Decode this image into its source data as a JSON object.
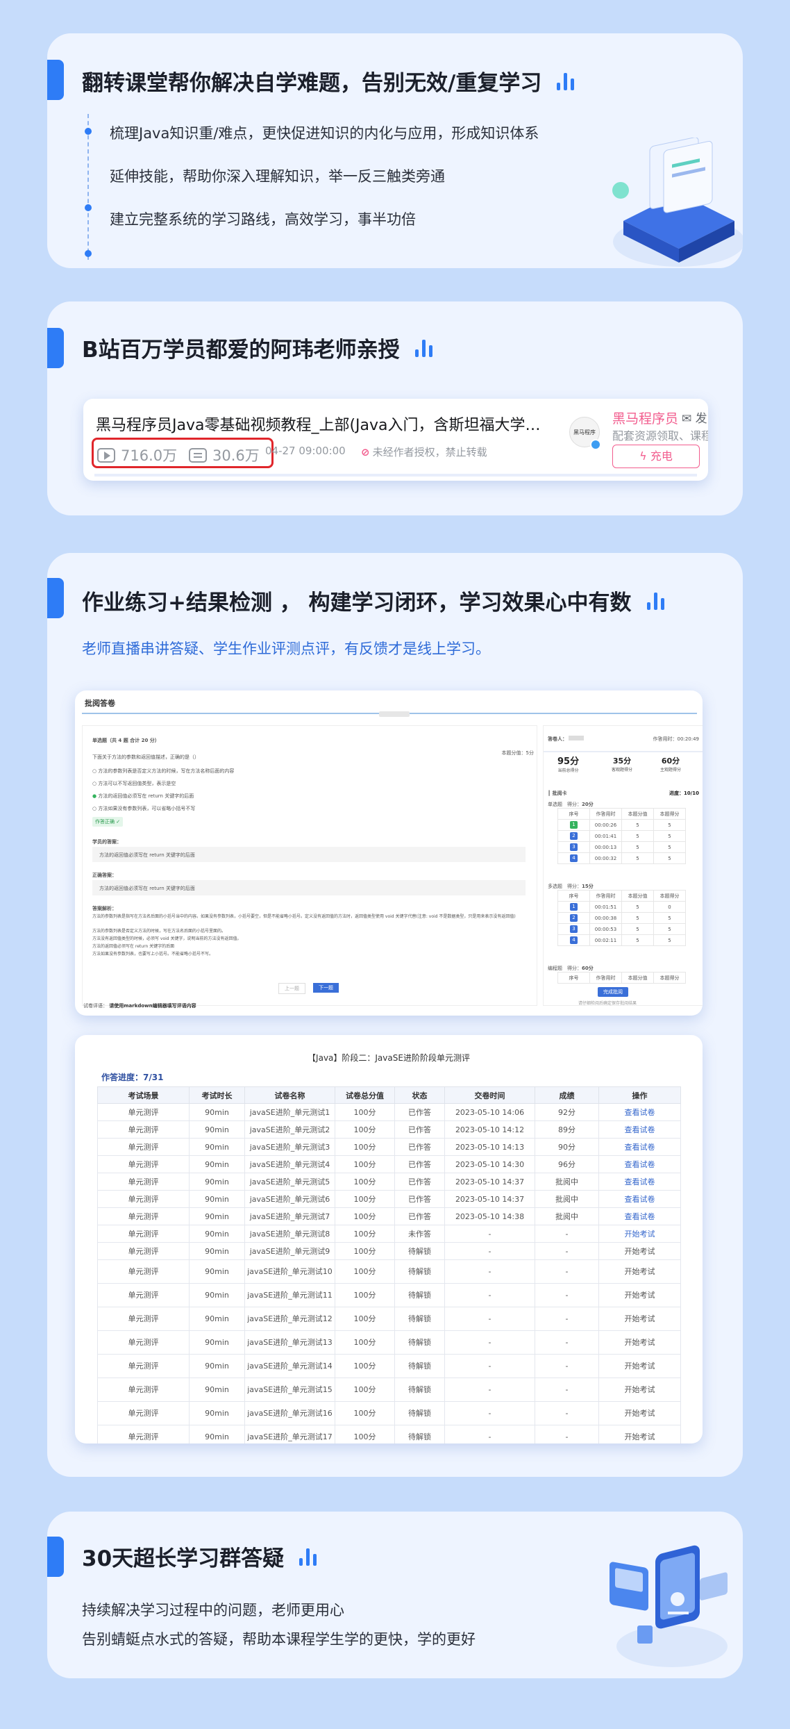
{
  "section1": {
    "title": "翻转课堂帮你解决自学难题，告别无效/重复学习",
    "bullets": [
      "梳理Java知识重/难点，更快促进知识的内化与应用，形成知识体系",
      "延伸技能，帮助你深入理解知识，举一反三触类旁通",
      "建立完整系统的学习路线，高效学习，事半功倍"
    ]
  },
  "section2": {
    "title": "B站百万学员都爱的阿玮老师亲授",
    "video": {
      "title": "黑马程序员Java零基础视频教程_上部(Java入门，含斯坦福大学…",
      "views": "716.0万",
      "danmaku": "30.6万",
      "date": "04-27 09:00:00",
      "notice": "未经作者授权，禁止转载",
      "uploader": "黑马程序员",
      "message": "发",
      "uploader_desc": "配套资源领取、课程",
      "avatar_text": "黑马程序",
      "charge": "充电"
    }
  },
  "section3": {
    "title": "作业练习+结果检测 ， 构建学习闭环，学习效果心中有数",
    "subtitle": "老师直播串讲答疑、学生作业评测点评，有反馈才是线上学习。",
    "grading": {
      "title": "批阅答卷",
      "question_header": "单选题（共 4 题 合计 20 分）",
      "question_score": "本题分值：5分",
      "question": "下面关于方法的参数和返回值描述，正确的是（）",
      "options": [
        "方法的参数列表是否定义方法的时候，写在方法名称后面的内容",
        "方法可以不写返回值类型，表示是空",
        "方法的返回值必须写在 return 关键字的后面",
        "方法如果没有参数列表，可以省略小括号不写"
      ],
      "correct_tag": "作答正确",
      "student_answer_label": "学员的答案：",
      "student_answer": "方法的返回值必须写在 return 关键字的后面",
      "correct_answer_label": "正确答案：",
      "correct_answer": "方法的返回值必须写在 return 关键字的后面",
      "analysis_label": "答案解析：",
      "analysis_lines": [
        "方法的参数列表是指写在方法名后面的小括号当中的内容。如果没有参数列表，小括号要空，但是不能省略小括号。定义没有返回值的方法时，返回值类型使用 void 关键字代替(注意: void 不是数据类型，只是用来表示没有返回值)",
        "方法的参数列表是否定义方法的时候，写在方法名后面的小括号里面的。",
        "方法没有返回值类型的时候，必须写 void 关键字，说明当前的方法没有返回值。",
        "方法的返回值必须写在 return 关键字的后面",
        "方法如果没有参数列表，也要写上小括号。不能省略小括号不写。"
      ],
      "prev": "上一题",
      "next": "下一题",
      "comment_label": "试卷评语：",
      "comment_placeholder": "请使用markdown编辑器填写评语内容",
      "answerer_label": "答卷人：",
      "time_label": "作答用时：",
      "time": "00:20:49",
      "scores": [
        {
          "value": "95分",
          "label": "当前总得分"
        },
        {
          "value": "35分",
          "label": "客观题得分"
        },
        {
          "value": "60分",
          "label": "主观题得分"
        }
      ],
      "panel_title": "批阅卡",
      "progress": "进度：10/10",
      "groups": [
        {
          "name": "单选题",
          "score_label": "得分：",
          "score": "20分",
          "rows": [
            [
              "1",
              "00:00:26",
              "5",
              "5"
            ],
            [
              "2",
              "00:01:41",
              "5",
              "5"
            ],
            [
              "3",
              "00:00:13",
              "5",
              "5"
            ],
            [
              "4",
              "00:00:32",
              "5",
              "5"
            ]
          ]
        },
        {
          "name": "多选题",
          "score_label": "得分：",
          "score": "15分",
          "rows": [
            [
              "1",
              "00:01:51",
              "5",
              "0"
            ],
            [
              "2",
              "00:00:38",
              "5",
              "5"
            ],
            [
              "3",
              "00:00:53",
              "5",
              "5"
            ],
            [
              "4",
              "00:02:11",
              "5",
              "5"
            ]
          ]
        },
        {
          "name": "编程题",
          "score_label": "得分：",
          "score": "60分",
          "rows": []
        }
      ],
      "mini_headers": [
        "序号",
        "作答用时",
        "本题分值",
        "本题得分"
      ],
      "finish_button": "完成批阅",
      "finish_hint": "请仔细检阅后确定保存批阅结果"
    },
    "exam": {
      "title": "【Java】阶段二：JavaSE进阶阶段单元测评",
      "progress": "作答进度：7/31",
      "headers": [
        "考试场景",
        "考试时长",
        "试卷名称",
        "试卷总分值",
        "状态",
        "交卷时间",
        "成绩",
        "操作"
      ],
      "rows": [
        [
          "单元测评",
          "90min",
          "javaSE进阶_单元测试1",
          "100分",
          "已作答",
          "2023-05-10 14:06",
          "92分",
          "查看试卷"
        ],
        [
          "单元测评",
          "90min",
          "javaSE进阶_单元测试2",
          "100分",
          "已作答",
          "2023-05-10 14:12",
          "89分",
          "查看试卷"
        ],
        [
          "单元测评",
          "90min",
          "javaSE进阶_单元测试3",
          "100分",
          "已作答",
          "2023-05-10 14:13",
          "90分",
          "查看试卷"
        ],
        [
          "单元测评",
          "90min",
          "javaSE进阶_单元测试4",
          "100分",
          "已作答",
          "2023-05-10 14:30",
          "96分",
          "查看试卷"
        ],
        [
          "单元测评",
          "90min",
          "javaSE进阶_单元测试5",
          "100分",
          "已作答",
          "2023-05-10 14:37",
          "批阅中",
          "查看试卷"
        ],
        [
          "单元测评",
          "90min",
          "javaSE进阶_单元测试6",
          "100分",
          "已作答",
          "2023-05-10 14:37",
          "批阅中",
          "查看试卷"
        ],
        [
          "单元测评",
          "90min",
          "javaSE进阶_单元测试7",
          "100分",
          "已作答",
          "2023-05-10 14:38",
          "批阅中",
          "查看试卷"
        ],
        [
          "单元测评",
          "90min",
          "javaSE进阶_单元测试8",
          "100分",
          "未作答",
          "-",
          "-",
          "开始考试"
        ],
        [
          "单元测评",
          "90min",
          "javaSE进阶_单元测试9",
          "100分",
          "待解锁",
          "-",
          "-",
          "开始考试"
        ],
        [
          "单元测评",
          "90min",
          "javaSE进阶_单元测试10",
          "100分",
          "待解锁",
          "-",
          "-",
          "开始考试"
        ],
        [
          "单元测评",
          "90min",
          "javaSE进阶_单元测试11",
          "100分",
          "待解锁",
          "-",
          "-",
          "开始考试"
        ],
        [
          "单元测评",
          "90min",
          "javaSE进阶_单元测试12",
          "100分",
          "待解锁",
          "-",
          "-",
          "开始考试"
        ],
        [
          "单元测评",
          "90min",
          "javaSE进阶_单元测试13",
          "100分",
          "待解锁",
          "-",
          "-",
          "开始考试"
        ],
        [
          "单元测评",
          "90min",
          "javaSE进阶_单元测试14",
          "100分",
          "待解锁",
          "-",
          "-",
          "开始考试"
        ],
        [
          "单元测评",
          "90min",
          "javaSE进阶_单元测试15",
          "100分",
          "待解锁",
          "-",
          "-",
          "开始考试"
        ],
        [
          "单元测评",
          "90min",
          "javaSE进阶_单元测试16",
          "100分",
          "待解锁",
          "-",
          "-",
          "开始考试"
        ],
        [
          "单元测评",
          "90min",
          "javaSE进阶_单元测试17",
          "100分",
          "待解锁",
          "-",
          "-",
          "开始考试"
        ]
      ]
    }
  },
  "section4": {
    "title": "30天超长学习群答疑",
    "lines": [
      "持续解决学习过程中的问题，老师更用心",
      "告别蜻蜓点水式的答疑，帮助本课程学生学的更快，学的更好"
    ]
  }
}
